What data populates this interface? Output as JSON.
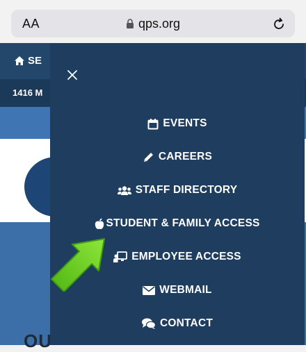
{
  "browser": {
    "text_size_label": "AA",
    "url": "qps.org"
  },
  "page": {
    "nav_label": "SE",
    "address_snippet": "1416 M",
    "lower_heading": "OU"
  },
  "menu": {
    "items": [
      {
        "label": "EVENTS",
        "icon": "calendar-icon"
      },
      {
        "label": "CAREERS",
        "icon": "pencil-icon"
      },
      {
        "label": "STAFF DIRECTORY",
        "icon": "users-icon"
      },
      {
        "label": "STUDENT & FAMILY ACCESS",
        "icon": "apple-icon"
      },
      {
        "label": "EMPLOYEE ACCESS",
        "icon": "chalkboard-teacher-icon"
      },
      {
        "label": "WEBMAIL",
        "icon": "envelope-icon"
      },
      {
        "label": "CONTACT",
        "icon": "comments-icon"
      }
    ]
  },
  "colors": {
    "menu_background": "#1e3d5f",
    "annotation_arrow": "#6bd21c"
  }
}
